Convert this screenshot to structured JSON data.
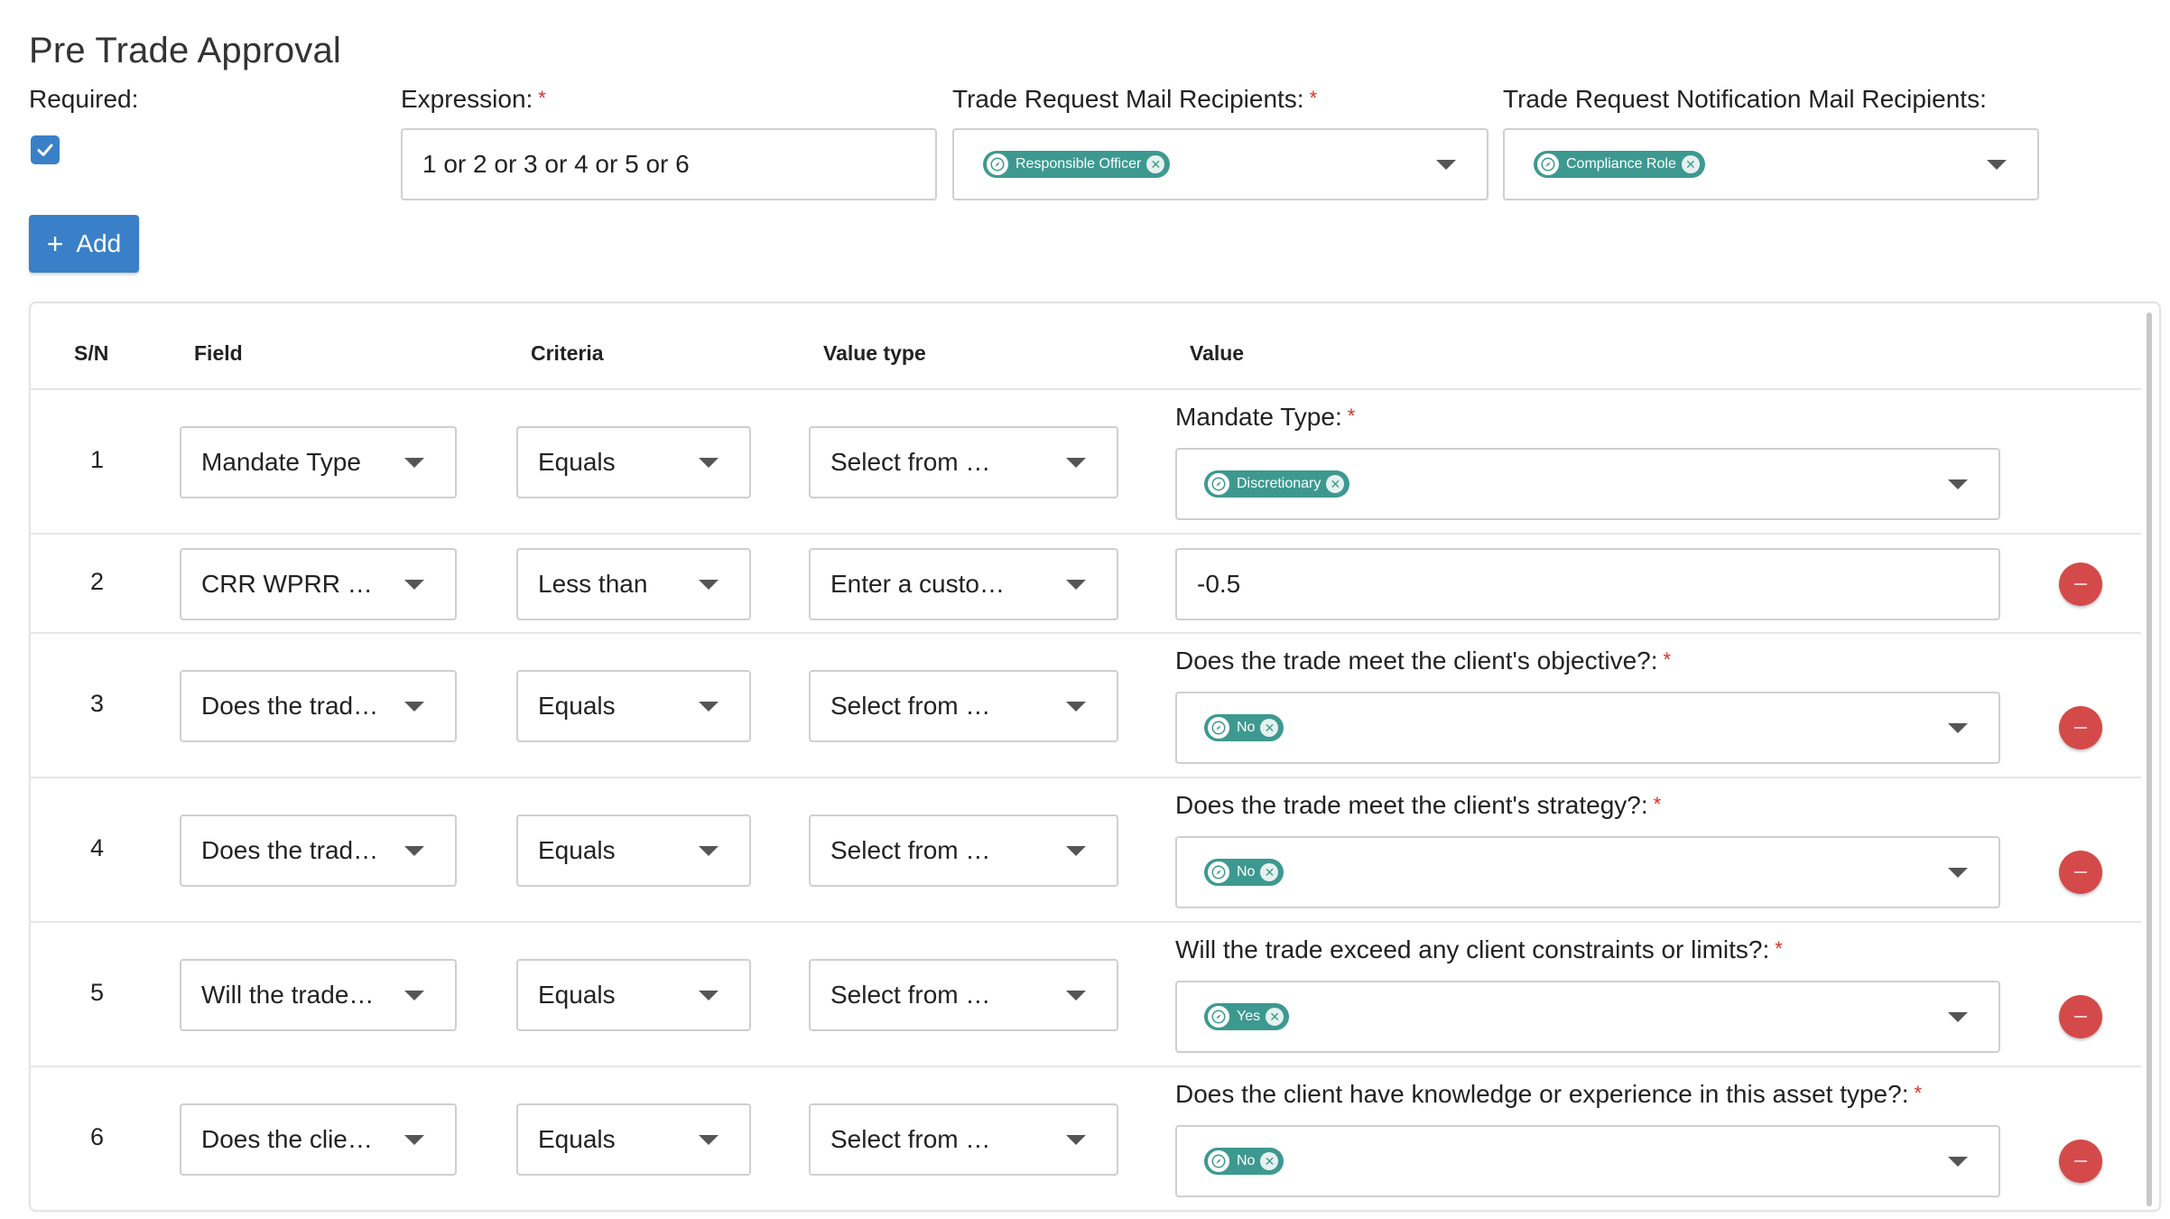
{
  "page": {
    "title": "Pre Trade Approval",
    "required_label": "Required:",
    "required_checked": true,
    "expression_label": "Expression:",
    "expression_value": "1 or 2 or 3 or 4 or 5 or 6",
    "mail_recipients_label": "Trade Request Mail Recipients:",
    "mail_recipients_chip": "Responsible Officer",
    "notification_recipients_label": "Trade Request Notification Mail Recipients:",
    "notification_recipients_chip": "Compliance Role",
    "add_button_label": "Add",
    "required_marker": "*"
  },
  "table": {
    "headers": {
      "sn": "S/N",
      "field": "Field",
      "criteria": "Criteria",
      "value_type": "Value type",
      "value": "Value"
    },
    "rows": [
      {
        "sn": "1",
        "field": "Mandate Type",
        "criteria": "Equals",
        "value_type": "Select from …",
        "value_label": "Mandate Type:",
        "value_chip": "Discretionary",
        "removable": false
      },
      {
        "sn": "2",
        "field": "CRR WPRR …",
        "criteria": "Less than",
        "value_type": "Enter a custo…",
        "value_input": "-0.5",
        "removable": true
      },
      {
        "sn": "3",
        "field": "Does the trad…",
        "criteria": "Equals",
        "value_type": "Select from …",
        "value_label": "Does the trade meet the client's objective?:",
        "value_chip": "No",
        "removable": true
      },
      {
        "sn": "4",
        "field": "Does the trad…",
        "criteria": "Equals",
        "value_type": "Select from …",
        "value_label": "Does the trade meet the client's strategy?:",
        "value_chip": "No",
        "removable": true
      },
      {
        "sn": "5",
        "field": "Will the trade…",
        "criteria": "Equals",
        "value_type": "Select from …",
        "value_label": "Will the trade exceed any client constraints or limits?:",
        "value_chip": "Yes",
        "removable": true
      },
      {
        "sn": "6",
        "field": "Does the clie…",
        "criteria": "Equals",
        "value_type": "Select from …",
        "value_label": "Does the client have knowledge or experience in this asset type?:",
        "value_chip": "No",
        "removable": true
      }
    ]
  },
  "colors": {
    "accent": "#3a80c8",
    "chip": "#3d9990",
    "danger": "#d44a4a",
    "required": "#d93025"
  },
  "icons": {
    "checkbox": "check-icon",
    "chip": "compass-icon",
    "chip_remove": "close-circle-icon",
    "dropdown": "caret-down-icon",
    "add": "plus-icon",
    "remove_row": "minus-icon"
  }
}
